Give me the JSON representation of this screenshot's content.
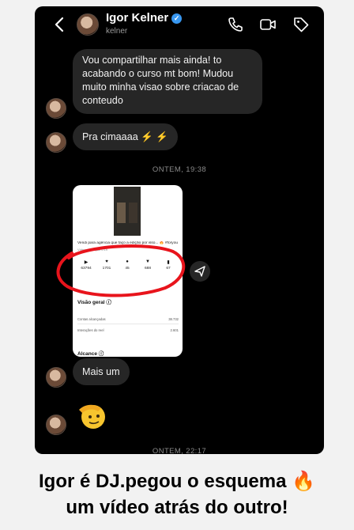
{
  "header": {
    "name": "Igor Kelner",
    "username": "kelner"
  },
  "messages": [
    {
      "text": "Vou compartilhar mais ainda! to acabando o curso mt bom! Mudou muito minha visao sobre criacao de conteudo"
    },
    {
      "text": "Pra cimaaaa ⚡ ⚡"
    },
    {
      "text": "Mais um"
    }
  ],
  "timestamps": [
    "ONTEM, 19:38",
    "ONTEM, 22:17"
  ],
  "shared_card": {
    "title": "Vendi para agência que faço a edição por isso... 🔥 #foryou",
    "subtitle": "Vídeo · Duração 0:19",
    "stats": [
      {
        "icon": "play-icon",
        "value": "63794"
      },
      {
        "icon": "heart-icon",
        "value": "1701"
      },
      {
        "icon": "comment-icon",
        "value": "45"
      },
      {
        "icon": "send-icon",
        "value": "688"
      },
      {
        "icon": "bookmark-icon",
        "value": "67"
      }
    ],
    "overview_label": "Visão geral",
    "rows": [
      {
        "label": "Contas alcançadas",
        "value": "38.732"
      },
      {
        "label": "Interações do reel",
        "value": "2.601"
      }
    ],
    "reach_label": "Alcance"
  },
  "caption": {
    "line1": "Igor é DJ.pegou o esquema 🔥",
    "line2": "um vídeo atrás do outro!"
  },
  "colors": {
    "bubble": "#262626",
    "verified": "#3897f0",
    "highlight_circle": "#e8141c"
  }
}
